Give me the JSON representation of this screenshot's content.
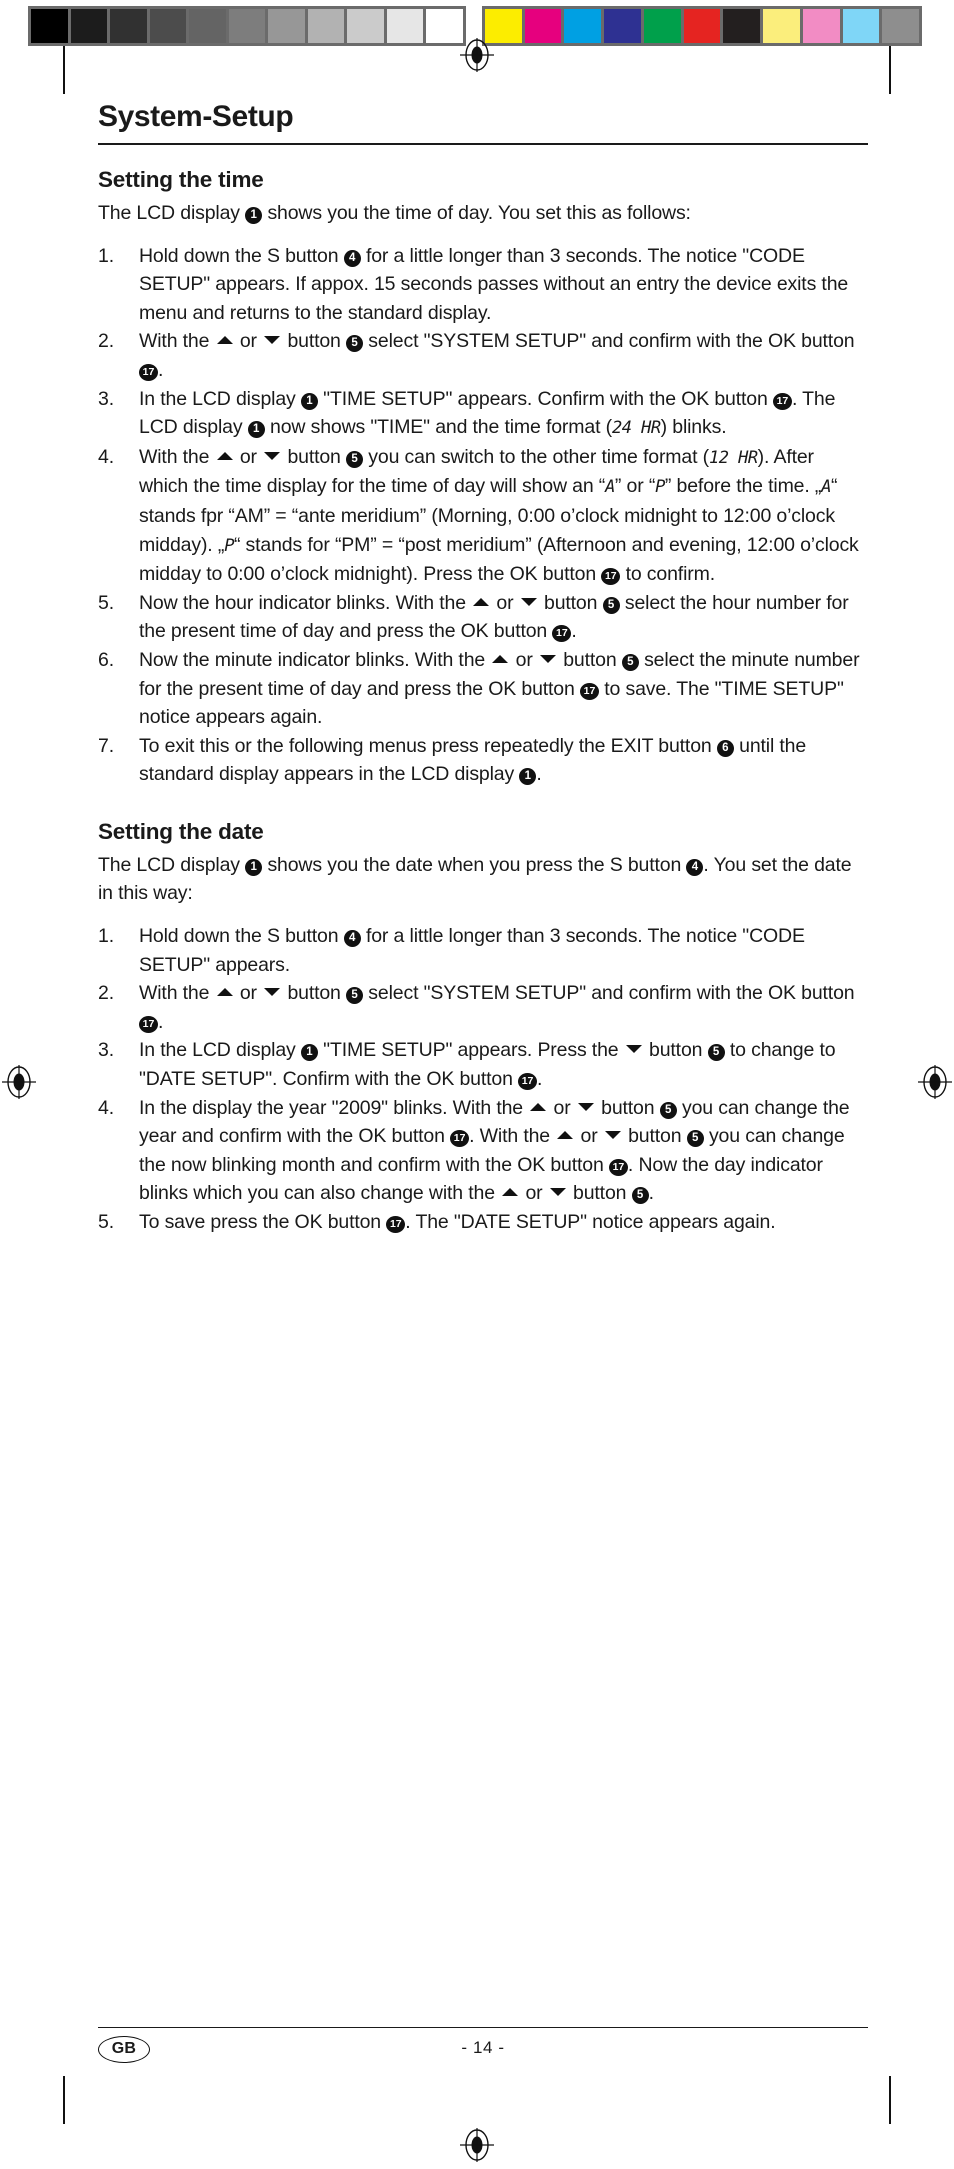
{
  "calibration": {
    "grayscale_label": "grayscale-step-wedge",
    "grayscale": [
      "#000000",
      "#1c1c1c",
      "#313131",
      "#4c4c4c",
      "#646464",
      "#7d7d7d",
      "#979797",
      "#b2b2b2",
      "#cbcbcb",
      "#e6e6e6",
      "#ffffff"
    ],
    "color_label": "color-control-patches",
    "colors": [
      "#fced00",
      "#e6007e",
      "#00a0e3",
      "#2e3192",
      "#00a04b",
      "#e52421",
      "#231f1f",
      "#fbee7c",
      "#f28cc4",
      "#7fd6f7",
      "#8e8e8e"
    ],
    "bar_frame": "#6b6b6b"
  },
  "document": {
    "title": "System-Setup",
    "sections": [
      {
        "heading": "Setting the time",
        "lead": "The LCD display ❶ shows you the time of day. You set this as follows:",
        "steps": [
          "1. Hold down the S button ❹ for a little longer than 3 seconds. The notice \"CODE SETUP\" appears. If appox. 15 seconds passes without an entry the device exits the menu and returns to the standard display.",
          "2. With the ▲ or ▼ button ❺ select \"SYSTEM SETUP\" and confirm with the OK button ⓱.",
          "3. In the LCD display ❶ \"TIME SETUP\" appears. Confirm with the OK button ⓱. The LCD display ❶ now shows \"TIME\" and the time format (24 HR) blinks.",
          "4. With the ▲ or ▼ button ❺ you can switch to the other time format (12 HR). After which the time display for the time of day will show an “A” or “P” before the time. „A“ stands fpr “AM” = “ante meridium” (Morning, 0:00 o’clock midnight to 12:00 o’clock midday). „P“ stands for “PM” = “post meridium” (Afternoon and evening, 12:00 o’clock midday to 0:00 o’clock midnight). Press the OK button ⓱ to confirm.",
          "5. Now the hour indicator blinks. With the ▲ or ▼ button ❺ select the hour number for the present time of day and press the OK button ⓱.",
          "6. Now the minute indicator blinks. With the ▲ or ▼ button ❺ select the minute number for the present time of day and press the OK button ⓱ to save. The \"TIME SETUP\" notice appears again.",
          "7. To exit this or the following menus press repeatedly the EXIT button ❻ until the standard display appears in the LCD display ❶."
        ]
      },
      {
        "heading": "Setting the date",
        "lead": "The LCD display ❶ shows you the date when you press the S button ❹. You set the date in this way:",
        "steps": [
          "1. Hold down the S button ❹ for a little longer than 3 seconds. The notice \"CODE SETUP\" appears.",
          "2. With the ▲ or ▼ button ❺ select \"SYSTEM SETUP\" and confirm with the OK button ⓱.",
          "3. In the LCD display ❶ \"TIME SETUP\" appears. Press the ▼ button ❺ to change to \"DATE SETUP\". Confirm with the OK button ⓱.",
          "4. In the display the year \"2009\" blinks. With the ▲ or ▼ button ❺ you can change the year and confirm with the OK button ⓱. With the ▲ or ▼ button ❺ you can change the now blinking month and confirm with the OK button ⓱. Now the day indicator blinks which you can also change with the ▲ or ▼ button ❺.",
          "5. To save press the OK button ⓱. The \"DATE SETUP\" notice appears again."
        ]
      }
    ]
  },
  "content": {
    "title": "System-Setup",
    "time_section": {
      "heading": "Setting the time",
      "lead_a": "The LCD display ",
      "lead_ref": "1",
      "lead_b": " shows you the time of day. You set this as follows:",
      "s1_num": "1.",
      "s1_a": "Hold down the S button ",
      "s1_ref": "4",
      "s1_b": " for a little longer than 3 seconds. The notice \"CODE SETUP\" appears. If appox. 15 seconds passes without an entry the device exits the menu and returns to the standard display.",
      "s2_num": "2.",
      "s2_a": "With the ",
      "s2_or": " or ",
      "s2_b": " button ",
      "s2_ref1": "5",
      "s2_c": " select \"SYSTEM SETUP\" and confirm with the OK button ",
      "s2_ref2": "17",
      "s2_d": ".",
      "s3_num": "3.",
      "s3_a": "In the LCD display ",
      "s3_ref1": "1",
      "s3_b": " \"TIME SETUP\" appears. Confirm with the OK button ",
      "s3_ref2": "17",
      "s3_c": ".  The LCD display ",
      "s3_ref3": "1",
      "s3_d": " now shows \"TIME\" and the time format (",
      "s3_lcd": "24 HR",
      "s3_e": ") blinks.",
      "s4_num": "4.",
      "s4_a": "With the ",
      "s4_or": " or ",
      "s4_b": " button ",
      "s4_ref1": "5",
      "s4_c": " you can switch to the other time format (",
      "s4_lcd1": "12 HR",
      "s4_d": "). After which the time display for the time of day will show an “",
      "s4_lcd2": "A",
      "s4_e": "” or “",
      "s4_lcd3": "P",
      "s4_f": "” before the time. „",
      "s4_lcd4": "A",
      "s4_g": "“ stands fpr “AM” = “ante meridium” (Morning, 0:00 o’clock midnight to 12:00 o’clock midday). „",
      "s4_lcd5": "P",
      "s4_h": "“ stands for “PM” = “post meridium” (Afternoon and evening, 12:00 o’clock midday to 0:00 o’clock midnight). Press the OK button ",
      "s4_ref2": "17",
      "s4_i": " to confirm.",
      "s5_num": "5.",
      "s5_a": "Now the hour indicator blinks. With the ",
      "s5_or": " or ",
      "s5_b": " button ",
      "s5_ref1": "5",
      "s5_c": " select the hour number for the present time of day and press the OK button ",
      "s5_ref2": "17",
      "s5_d": ".",
      "s6_num": "6.",
      "s6_a": "Now the minute indicator blinks. With the ",
      "s6_or": " or ",
      "s6_b": " button ",
      "s6_ref1": "5",
      "s6_c": " select the minute number for the present time of day and press the OK button ",
      "s6_ref2": "17",
      "s6_d": " to save. The \"TIME SETUP\" notice appears again.",
      "s7_num": "7.",
      "s7_a": "To exit this or the following menus press repeatedly the EXIT button ",
      "s7_ref1": "6",
      "s7_b": " until the standard display appears in the LCD display ",
      "s7_ref2": "1",
      "s7_c": "."
    },
    "date_section": {
      "heading": "Setting the date",
      "lead_a": "The LCD display ",
      "lead_ref1": "1",
      "lead_b": " shows you the date when you press the S button ",
      "lead_ref2": "4",
      "lead_c": ". You set the date in this way:",
      "d1_num": "1.",
      "d1_a": "Hold down the S button ",
      "d1_ref": "4",
      "d1_b": " for a little longer than 3 seconds. The notice \"CODE SETUP\" appears.",
      "d2_num": "2.",
      "d2_a": "With the ",
      "d2_or": " or ",
      "d2_b": " button ",
      "d2_ref1": "5",
      "d2_c": " select \"SYSTEM SETUP\" and confirm with the OK button ",
      "d2_ref2": "17",
      "d2_d": ".",
      "d3_num": "3.",
      "d3_a": "In the LCD display ",
      "d3_ref1": "1",
      "d3_b": " \"TIME SETUP\" appears. Press the ",
      "d3_c": " button ",
      "d3_ref2": "5",
      "d3_d": " to change to \"DATE SETUP\". Confirm with the OK button ",
      "d3_ref3": "17",
      "d3_e": ".",
      "d4_num": "4.",
      "d4_a": "In the display the year \"2009\" blinks. With the ",
      "d4_or": " or ",
      "d4_b": " button ",
      "d4_ref1": "5",
      "d4_c": " you can change the year and confirm with the OK button ",
      "d4_ref2": "17",
      "d4_d": ". With the ",
      "d4_or2": " or ",
      "d4_e": " button ",
      "d4_ref3": "5",
      "d4_f": " you can change the now blinking month and confirm with the OK button ",
      "d4_ref4": "17",
      "d4_g": ". Now the day indicator blinks which you can also change with the ",
      "d4_or3": " or ",
      "d4_h": " button ",
      "d4_ref5": "5",
      "d4_i": ".",
      "d5_num": "5.",
      "d5_a": "To save press the OK button ",
      "d5_ref1": "17",
      "d5_b": ". The \"DATE SETUP\" notice appears again."
    },
    "footer": {
      "locale": "GB",
      "page_number": "- 14 -"
    }
  }
}
